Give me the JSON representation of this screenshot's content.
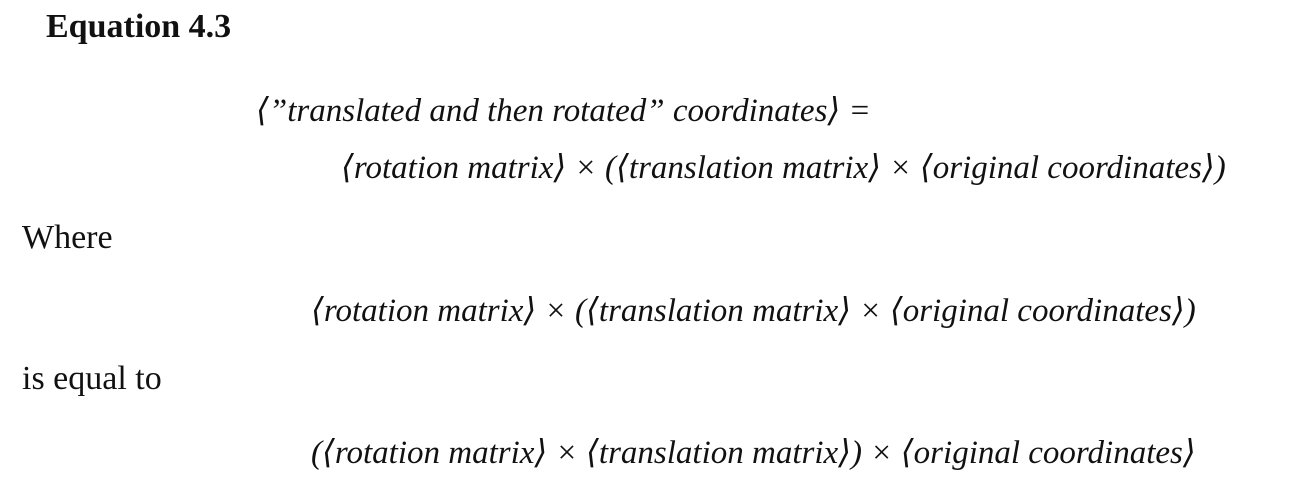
{
  "heading": "Equation 4.3",
  "equation_main": {
    "line1": "⟨”translated and then rotated” coordinates⟩ =",
    "line2": "⟨rotation matrix⟩ × (⟨translation matrix⟩ × ⟨original coordinates⟩)"
  },
  "where_text": "Where",
  "equation_where": "⟨rotation matrix⟩ × (⟨translation matrix⟩ × ⟨original coordinates⟩)",
  "equal_text": "is equal to",
  "equation_equal": "(⟨rotation matrix⟩ × ⟨translation matrix⟩) × ⟨original coordinates⟩"
}
